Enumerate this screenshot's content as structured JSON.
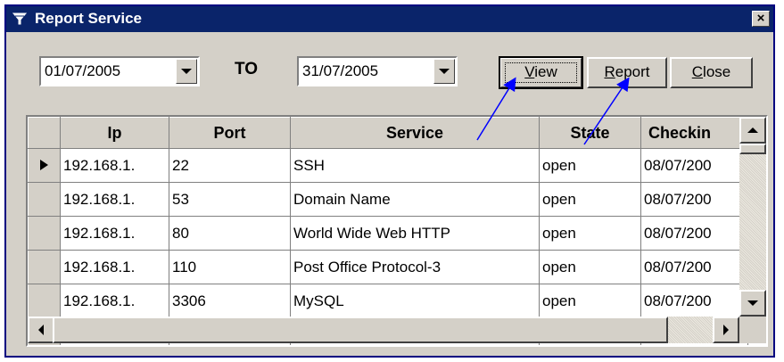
{
  "window": {
    "title": "Report Service",
    "close_label": "×"
  },
  "filters": {
    "from_date": "01/07/2005",
    "to_label": "TO",
    "to_date": "31/07/2005"
  },
  "buttons": {
    "view": {
      "accel": "V",
      "rest": "iew"
    },
    "report": {
      "accel": "R",
      "rest": "eport"
    },
    "close": {
      "accel": "C",
      "rest": "lose"
    }
  },
  "grid": {
    "columns": [
      "Ip",
      "Port",
      "Service",
      "State",
      "Checkin"
    ],
    "rows": [
      [
        "192.168.1.",
        "22",
        "SSH",
        "open",
        "08/07/200"
      ],
      [
        "192.168.1.",
        "53",
        "Domain Name",
        "open",
        "08/07/200"
      ],
      [
        "192.168.1.",
        "80",
        "World Wide Web HTTP",
        "open",
        "08/07/200"
      ],
      [
        "192.168.1.",
        "110",
        "Post Office Protocol-3",
        "open",
        "08/07/200"
      ],
      [
        "192.168.1.",
        "3306",
        "MySQL",
        "open",
        "08/07/200"
      ]
    ],
    "current_row": 0
  },
  "colors": {
    "titlebar": "#0a246a",
    "face": "#d4d0c8",
    "annotation": "#0000ff"
  },
  "icons": [
    "window-menu-icon",
    "close-icon",
    "dropdown-arrow-icon",
    "current-row-icon",
    "scroll-up-icon",
    "scroll-down-icon",
    "scroll-left-icon",
    "scroll-right-icon"
  ]
}
